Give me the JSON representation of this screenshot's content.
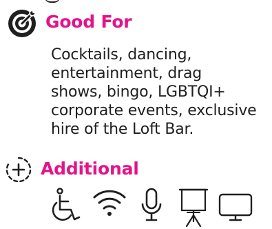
{
  "good_for": {
    "title": "Good For",
    "icon": "target-icon",
    "description": "Cocktails, dancing,\nentertainment, drag\nshows, bingo, LGBTQI+\ncorporate events, exclusive\nhire of the Loft Bar."
  },
  "additional": {
    "title": "Additional",
    "icon": "plus-circle-icon",
    "amenities": [
      {
        "icon": "wheelchair-accessible-icon"
      },
      {
        "icon": "wifi-icon"
      },
      {
        "icon": "microphone-icon"
      },
      {
        "icon": "projector-screen-icon"
      },
      {
        "icon": "monitor-icon"
      }
    ]
  },
  "colors": {
    "accent": "#e3138a",
    "text": "#1f1f1f",
    "background": "#ffffff"
  }
}
